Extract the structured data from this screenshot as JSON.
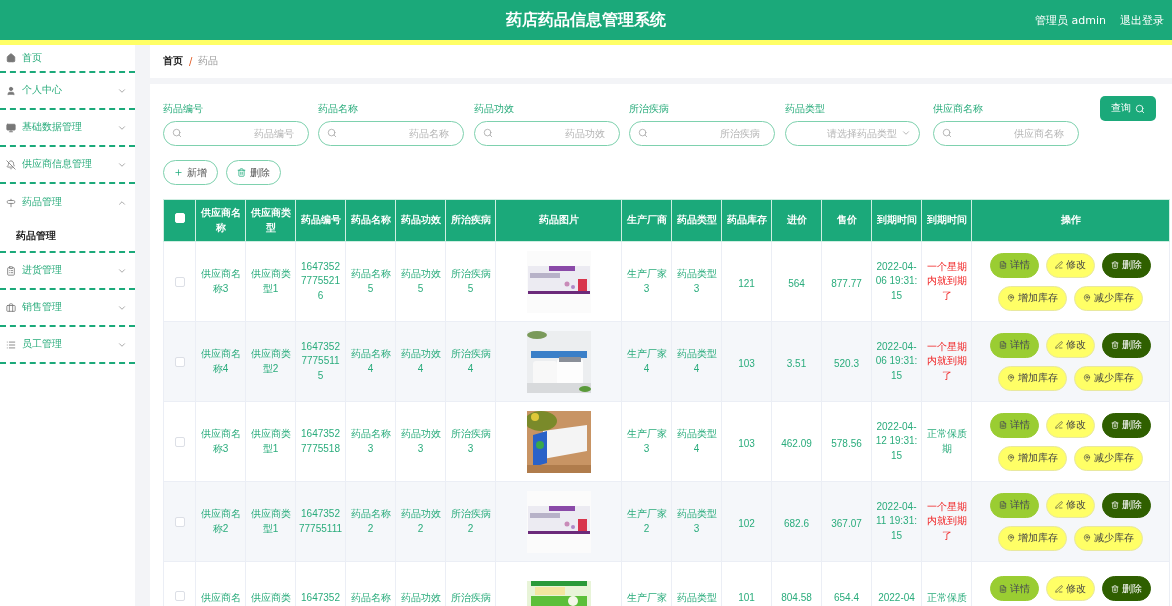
{
  "header": {
    "title": "药店药品信息管理系统",
    "user": "管理员 admin",
    "logout": "退出登录"
  },
  "sidebar": {
    "items": [
      {
        "label": "首页",
        "kind": "link"
      },
      {
        "label": "个人中心",
        "kind": "menu",
        "expanded": false
      },
      {
        "label": "基础数据管理",
        "kind": "menu",
        "expanded": false
      },
      {
        "label": "供应商信息管理",
        "kind": "menu",
        "expanded": false
      },
      {
        "label": "药品管理",
        "kind": "menu",
        "expanded": true,
        "children": [
          {
            "label": "药品管理",
            "selected": true
          }
        ]
      },
      {
        "label": "进货管理",
        "kind": "menu",
        "expanded": false
      },
      {
        "label": "销售管理",
        "kind": "menu",
        "expanded": false
      },
      {
        "label": "员工管理",
        "kind": "menu",
        "expanded": false
      }
    ]
  },
  "breadcrumb": {
    "items": [
      "首页",
      "药品"
    ],
    "separator": "/"
  },
  "search": {
    "fields": [
      {
        "label": "药品编号",
        "placeholder": "药品编号",
        "kind": "text"
      },
      {
        "label": "药品名称",
        "placeholder": "药品名称",
        "kind": "text"
      },
      {
        "label": "药品功效",
        "placeholder": "药品功效",
        "kind": "text"
      },
      {
        "label": "所治疾病",
        "placeholder": "所治疾病",
        "kind": "text"
      },
      {
        "label": "药品类型",
        "placeholder": "请选择药品类型",
        "kind": "select"
      },
      {
        "label": "供应商名称",
        "placeholder": "供应商名称",
        "kind": "text"
      }
    ],
    "query_button": "查询"
  },
  "toolbar": [
    {
      "label": "新增",
      "kind": "add"
    },
    {
      "label": "删除",
      "kind": "delete"
    }
  ],
  "table": {
    "select_all": {
      "checked": false
    },
    "columns": [
      "供应商名称",
      "供应商类型",
      "药品编号",
      "药品名称",
      "药品功效",
      "所治疾病",
      "药品图片",
      "生产厂商",
      "药品类型",
      "药品库存",
      "进价",
      "售价",
      "到期时间",
      "到期时间",
      "操作"
    ],
    "rows": [
      {
        "kind": "full",
        "checked": false,
        "cells_a": [
          "供应商名称3",
          "供应商类型1",
          "164735277755216",
          "药品名称5",
          "药品功效5",
          "所治疾病5"
        ],
        "image": {
          "kind": "picture"
        },
        "cells_b": [
          "生产厂家3",
          "药品类型3",
          "121",
          "564",
          "877.77",
          "2022-04-06 19:31:15"
        ],
        "expiry_status": {
          "text": "一个星期内就到期了",
          "kind": "warning"
        },
        "actions": [
          {
            "label": "详情",
            "kind": "detail"
          },
          {
            "label": "修改",
            "kind": "edit"
          },
          {
            "label": "删除",
            "kind": "delete"
          },
          {
            "label": "增加库存",
            "kind": "stock"
          },
          {
            "label": "减少库存",
            "kind": "stock"
          }
        ]
      },
      {
        "kind": "full",
        "checked": false,
        "cells_a": [
          "供应商名称4",
          "供应商类型2",
          "164735277755115",
          "药品名称4",
          "药品功效4",
          "所治疾病4"
        ],
        "image": {
          "kind": "picture"
        },
        "cells_b": [
          "生产厂家4",
          "药品类型4",
          "103",
          "3.51",
          "520.3",
          "2022-04-06 19:31:15"
        ],
        "expiry_status": {
          "text": "一个星期内就到期了",
          "kind": "warning"
        },
        "actions": [
          {
            "label": "详情",
            "kind": "detail"
          },
          {
            "label": "修改",
            "kind": "edit"
          },
          {
            "label": "删除",
            "kind": "delete"
          },
          {
            "label": "增加库存",
            "kind": "stock"
          },
          {
            "label": "减少库存",
            "kind": "stock"
          }
        ]
      },
      {
        "kind": "full",
        "checked": false,
        "cells_a": [
          "供应商名称3",
          "供应商类型1",
          "16473527775518",
          "药品名称3",
          "药品功效3",
          "所治疾病3"
        ],
        "image": {
          "kind": "picture"
        },
        "cells_b": [
          "生产厂家3",
          "药品类型4",
          "103",
          "462.09",
          "578.56",
          "2022-04-12 19:31:15"
        ],
        "expiry_status": {
          "text": "正常保质期",
          "kind": "normal"
        },
        "actions": [
          {
            "label": "详情",
            "kind": "detail"
          },
          {
            "label": "修改",
            "kind": "edit"
          },
          {
            "label": "删除",
            "kind": "delete"
          },
          {
            "label": "增加库存",
            "kind": "stock"
          },
          {
            "label": "减少库存",
            "kind": "stock"
          }
        ]
      },
      {
        "kind": "full",
        "checked": false,
        "cells_a": [
          "供应商名称2",
          "供应商类型1",
          "164735277755111",
          "药品名称2",
          "药品功效2",
          "所治疾病2"
        ],
        "image": {
          "kind": "picture"
        },
        "cells_b": [
          "生产厂家2",
          "药品类型3",
          "102",
          "682.6",
          "367.07",
          "2022-04-11 19:31:15"
        ],
        "expiry_status": {
          "text": "一个星期内就到期了",
          "kind": "warning"
        },
        "actions": [
          {
            "label": "详情",
            "kind": "detail"
          },
          {
            "label": "修改",
            "kind": "edit"
          },
          {
            "label": "删除",
            "kind": "delete"
          },
          {
            "label": "增加库存",
            "kind": "stock"
          },
          {
            "label": "减少库存",
            "kind": "stock"
          }
        ]
      },
      {
        "kind": "partial",
        "checked": false,
        "cells_a": [
          "供应商名",
          "供应商类",
          "1647352",
          "药品名称",
          "药品功效",
          "所治疾病"
        ],
        "image": {
          "kind": "picture"
        },
        "cells_b": [
          "生产厂家",
          "药品类型",
          "101",
          "804.58",
          "654.4",
          "2022-04"
        ],
        "expiry_status": {
          "text": "正常保质",
          "kind": "normal"
        },
        "actions": [
          {
            "label": "详情",
            "kind": "detail"
          },
          {
            "label": "修改",
            "kind": "edit"
          },
          {
            "label": "删除",
            "kind": "delete"
          }
        ]
      }
    ]
  }
}
